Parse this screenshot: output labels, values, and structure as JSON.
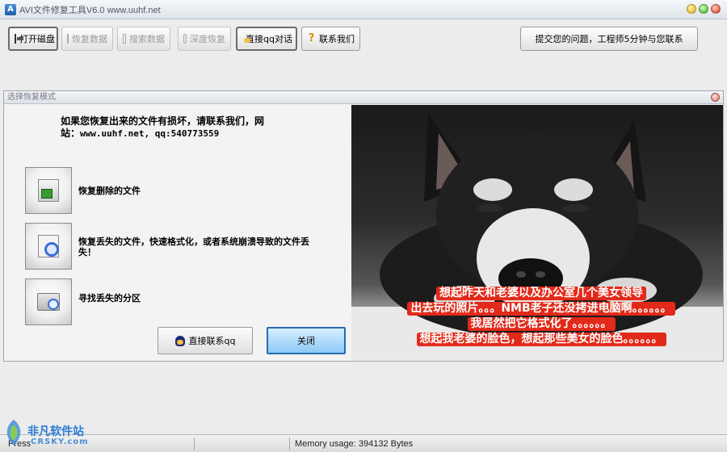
{
  "window": {
    "title": "AVI文件修复工具V6.0 www.uuhf.net"
  },
  "toolbar": {
    "buttons": [
      {
        "label": "打开磁盘",
        "icon": "disk-icon",
        "enabled": true
      },
      {
        "label": "恢复数据",
        "icon": "restore-icon",
        "enabled": false
      },
      {
        "label": "搜索数据",
        "icon": "search-data-icon",
        "enabled": false
      },
      {
        "label": "深度恢复",
        "icon": "deep-restore-icon",
        "enabled": false
      },
      {
        "label": "直接qq对话",
        "icon": "qq-icon",
        "enabled": true
      },
      {
        "label": "联系我们",
        "icon": "help-icon",
        "enabled": true
      }
    ],
    "submit_label": "提交您的问题，工程师5分钟与您联系"
  },
  "dialog": {
    "title": "选择恢复模式",
    "notice_line1": "如果您恢复出来的文件有损坏，请联系我们，网",
    "notice_line2_prefix": "站：",
    "notice_line2_url": "www.uuhf.net, qq:540773559",
    "options": [
      {
        "label": "恢复删除的文件",
        "icon": "recover-deleted-icon"
      },
      {
        "label": "恢复丢失的文件，快速格式化，或者系统崩溃导致的文件丢失！",
        "icon": "recover-lost-icon"
      },
      {
        "label": "寻找丢失的分区",
        "icon": "find-partition-icon"
      }
    ],
    "qq_button_label": "直接联系qq",
    "close_button_label": "关闭",
    "photo_caption": [
      "想起昨天和老婆以及办公室几个美女领导",
      "出去玩的照片。。。NMB老子还没拷进电脑啊。。。。。。",
      "我居然把它格式化了。。。。。。",
      "想起我老婆的脸色，想起那些美女的脸色。。。。。。"
    ]
  },
  "statusbar": {
    "left": "Press",
    "memory": "Memory usage: 394132 Bytes"
  },
  "watermark": {
    "text": "非凡软件站",
    "sub": "CRSKY.com"
  },
  "colors": {
    "caption_bg": "#e22a1a",
    "close_button": "#8ccaf6",
    "watermark": "#2a7ad4"
  }
}
